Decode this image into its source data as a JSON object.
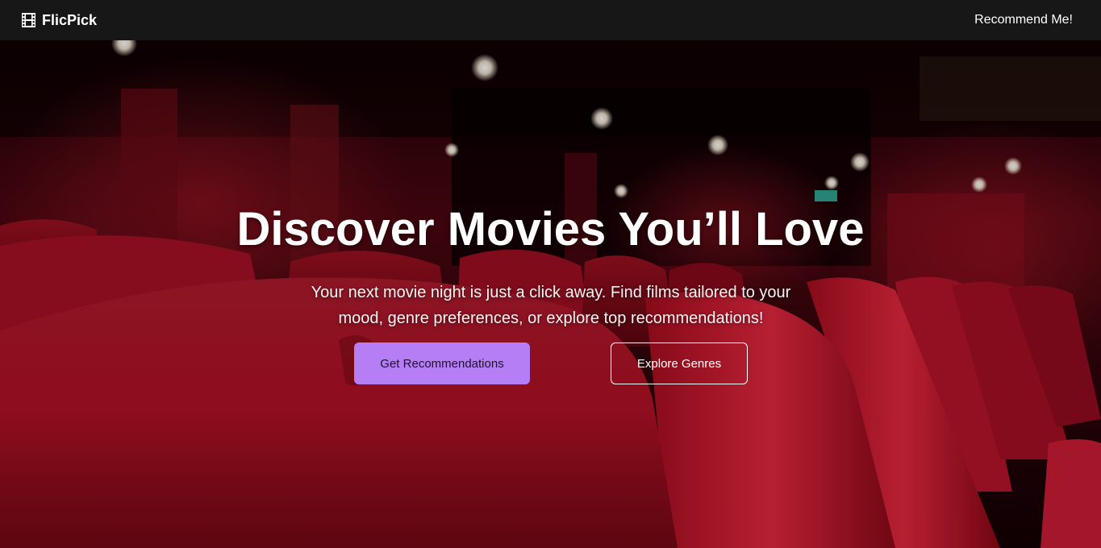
{
  "navbar": {
    "brand_icon": "film-icon",
    "brand_name": "FlicPick",
    "link_label": "Recommend Me!"
  },
  "hero": {
    "background": "theater-seats-photo",
    "title": "Discover Movies You’ll Love",
    "subtitle": "Your next movie night is just a click away. Find films tailored to your mood, genre preferences, or explore top recommendations!",
    "primary_button": "Get Recommendations",
    "secondary_button": "Explore Genres"
  },
  "colors": {
    "navbar_bg": "#171717",
    "accent": "#b57ef5",
    "text": "#ffffff",
    "seat_red": "#c8102e"
  }
}
